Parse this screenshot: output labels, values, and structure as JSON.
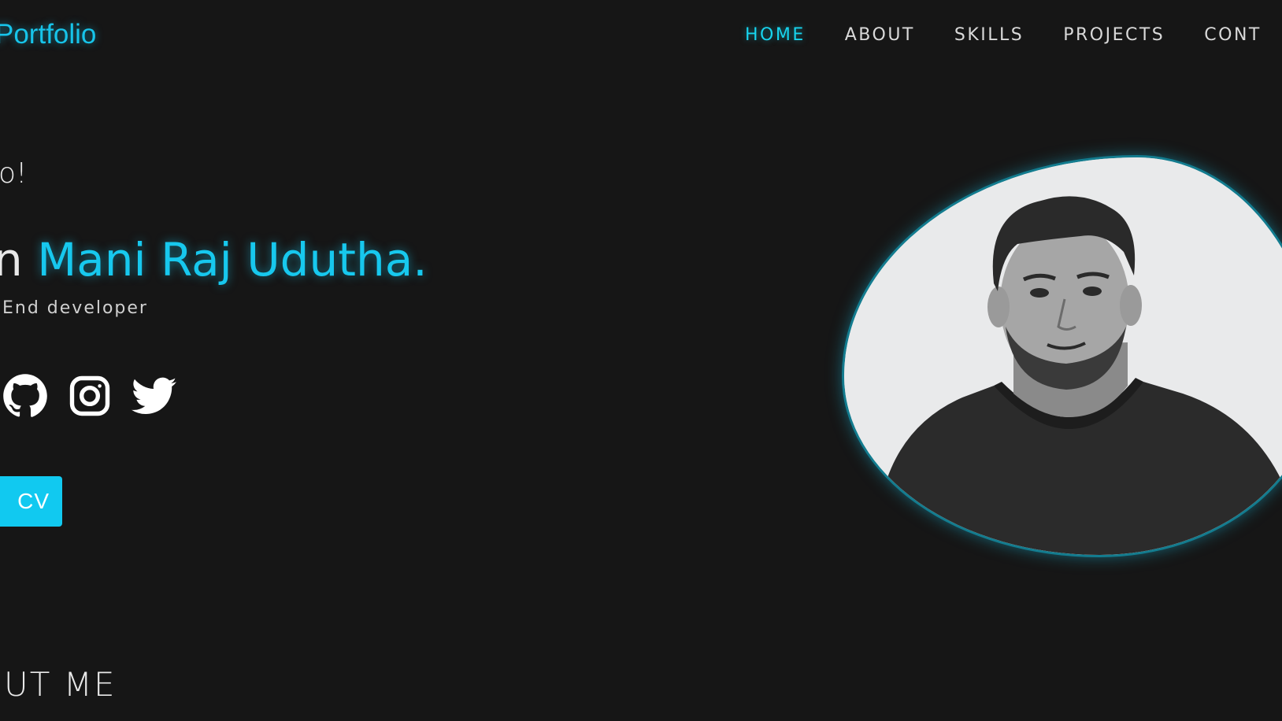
{
  "header": {
    "logo": "Portfolio",
    "nav": [
      {
        "label": "HOME",
        "active": true
      },
      {
        "label": "ABOUT",
        "active": false
      },
      {
        "label": "SKILLS",
        "active": false
      },
      {
        "label": "PROJECTS",
        "active": false
      },
      {
        "label": "CONT",
        "active": false
      }
    ]
  },
  "hero": {
    "greeting": "o!",
    "intro_prefix": "n ",
    "name": "Mani Raj Udutha.",
    "role": "End developer",
    "socials": [
      {
        "icon": "github-icon"
      },
      {
        "icon": "instagram-icon"
      },
      {
        "icon": "twitter-icon"
      }
    ],
    "cv_button": "CV"
  },
  "about": {
    "heading": "OUT ME"
  },
  "colors": {
    "accent": "#17c8ee",
    "background": "#161616",
    "text": "#e8e8e8"
  }
}
